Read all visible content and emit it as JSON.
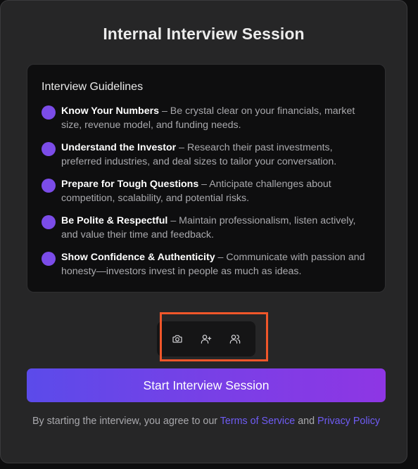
{
  "page": {
    "title": "Internal Interview Session"
  },
  "guidelines": {
    "heading": "Interview Guidelines",
    "items": [
      {
        "title": "Know Your Numbers",
        "text": " – Be crystal clear on your financials, market size, revenue model, and funding needs."
      },
      {
        "title": "Understand the Investor",
        "text": " – Research their past investments, preferred industries, and deal sizes to tailor your conversation."
      },
      {
        "title": "Prepare for Tough Questions",
        "text": " – Anticipate challenges about competition, scalability, and potential risks."
      },
      {
        "title": "Be Polite & Respectful",
        "text": " – Maintain professionalism, listen actively, and value their time and feedback."
      },
      {
        "title": "Show Confidence & Authenticity",
        "text": " – Communicate with passion and honesty—investors invest in people as much as ideas."
      }
    ]
  },
  "toolbar": {
    "buttons": [
      {
        "icon": "camera-icon"
      },
      {
        "icon": "user-plus-icon"
      },
      {
        "icon": "users-icon"
      }
    ]
  },
  "actions": {
    "start_label": "Start Interview Session"
  },
  "legal": {
    "prefix": "By starting the interview, you agree to our ",
    "terms_label": "Terms of Service",
    "and": " and ",
    "privacy_label": "Privacy Policy"
  },
  "colors": {
    "accent": "#7b4ce8",
    "link": "#6f5cf5",
    "highlight": "#f0562a"
  }
}
